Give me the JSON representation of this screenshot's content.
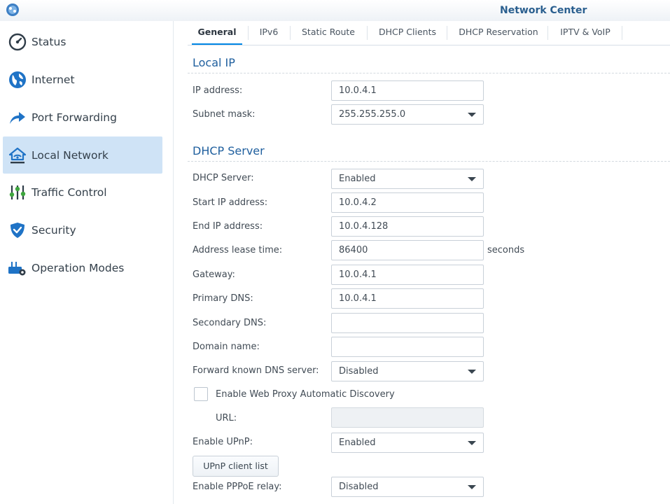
{
  "window": {
    "title": "Network Center",
    "logo_icon": "synology-router-icon"
  },
  "sidebar": {
    "items": [
      {
        "label": "Status",
        "icon": "gauge-icon",
        "active": false
      },
      {
        "label": "Internet",
        "icon": "globe-icon",
        "active": false
      },
      {
        "label": "Port Forwarding",
        "icon": "arrow-forward-icon",
        "active": false
      },
      {
        "label": "Local Network",
        "icon": "home-network-icon",
        "active": true
      },
      {
        "label": "Traffic Control",
        "icon": "sliders-icon",
        "active": false
      },
      {
        "label": "Security",
        "icon": "shield-icon",
        "active": false
      },
      {
        "label": "Operation Modes",
        "icon": "router-gear-icon",
        "active": false
      }
    ]
  },
  "tabs": [
    "General",
    "IPv6",
    "Static Route",
    "DHCP Clients",
    "DHCP Reservation",
    "IPTV & VoIP"
  ],
  "active_tab": "General",
  "local_ip": {
    "title": "Local IP",
    "ip_address": {
      "label": "IP address:",
      "value": "10.0.4.1"
    },
    "subnet_mask": {
      "label": "Subnet mask:",
      "value": "255.255.255.0"
    }
  },
  "dhcp": {
    "title": "DHCP Server",
    "server": {
      "label": "DHCP Server:",
      "value": "Enabled"
    },
    "start_ip": {
      "label": "Start IP address:",
      "value": "10.0.4.2"
    },
    "end_ip": {
      "label": "End IP address:",
      "value": "10.0.4.128"
    },
    "lease": {
      "label": "Address lease time:",
      "value": "86400",
      "unit": "seconds"
    },
    "gateway": {
      "label": "Gateway:",
      "value": "10.0.4.1"
    },
    "primary_dns": {
      "label": "Primary DNS:",
      "value": "10.0.4.1"
    },
    "secondary_dns": {
      "label": "Secondary DNS:",
      "value": ""
    },
    "domain": {
      "label": "Domain name:",
      "value": ""
    },
    "forward_dns": {
      "label": "Forward known DNS server:",
      "value": "Disabled"
    },
    "wpad": {
      "label": "Enable Web Proxy Automatic Discovery",
      "checked": false
    },
    "url": {
      "label": "URL:",
      "value": ""
    },
    "upnp": {
      "label": "Enable UPnP:",
      "value": "Enabled"
    },
    "upnp_button": "UPnP client list",
    "pppoe": {
      "label": "Enable PPPoE relay:",
      "value": "Disabled"
    }
  },
  "colors": {
    "accent": "#0086e5",
    "active_nav": "#cfe3f6",
    "section_title": "#1f5f9e"
  }
}
